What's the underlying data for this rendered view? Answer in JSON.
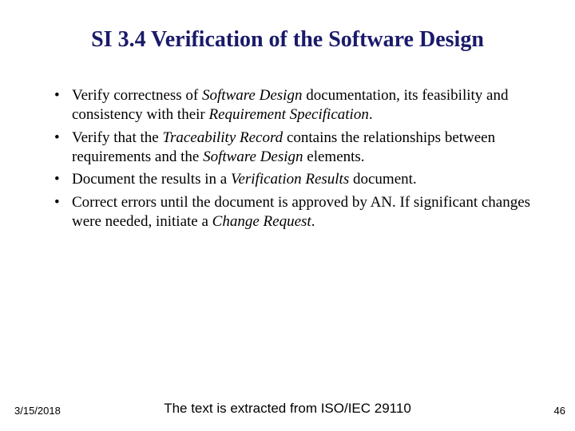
{
  "title": "SI 3.4 Verification of the Software Design",
  "bullets": [
    {
      "pre": "Verify correctness of ",
      "i1": "Software Design",
      "mid": " documentation, its feasibility and consistency with their ",
      "i2": "Requirement Specification",
      "post": "."
    },
    {
      "pre": "Verify that the ",
      "i1": "Traceability Record",
      "mid": " contains the relationships between requirements and the ",
      "i2": "Software Design",
      "post": " elements."
    },
    {
      "pre": "Document the results in a ",
      "i1": "Verification Results",
      "mid": " document.",
      "i2": "",
      "post": ""
    },
    {
      "pre": "Correct errors until the document is approved by AN.  If significant changes were needed, initiate a ",
      "i1": "Change Request",
      "mid": ".",
      "i2": "",
      "post": ""
    }
  ],
  "footer": {
    "date": "3/15/2018",
    "note": "The text is extracted from ISO/IEC 29110",
    "page": "46"
  }
}
